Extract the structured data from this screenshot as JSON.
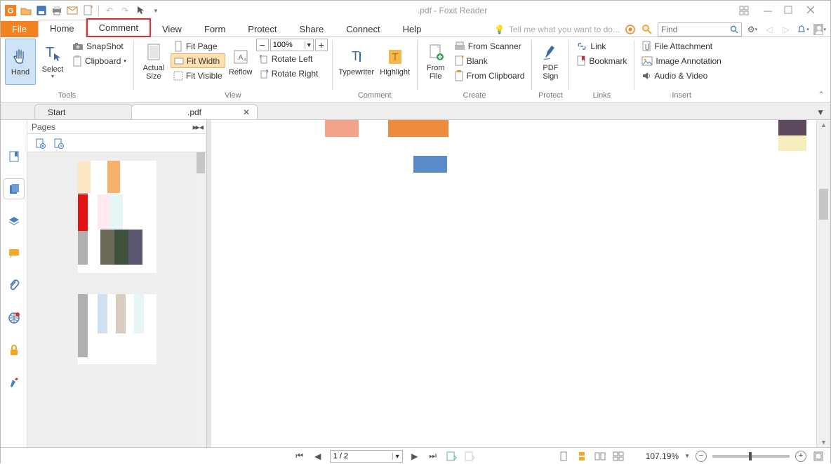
{
  "title": ".pdf - Foxit Reader",
  "tabs": {
    "file": "File",
    "home": "Home",
    "comment": "Comment",
    "view": "View",
    "form": "Form",
    "protect": "Protect",
    "share": "Share",
    "connect": "Connect",
    "help": "Help"
  },
  "search_hint": "Tell me what you want to do...",
  "find_placeholder": "Find",
  "ribbon": {
    "hand": "Hand",
    "select": "Select",
    "snapshot": "SnapShot",
    "clipboard": "Clipboard",
    "actual_size": "Actual\nSize",
    "fit_page": "Fit Page",
    "fit_width": "Fit Width",
    "fit_visible": "Fit Visible",
    "reflow": "Reflow",
    "rotate_left": "Rotate Left",
    "rotate_right": "Rotate Right",
    "zoom_value": "100%",
    "typewriter": "Typewriter",
    "highlight": "Highlight",
    "from_file": "From\nFile",
    "from_scanner": "From Scanner",
    "blank": "Blank",
    "from_clipboard": "From Clipboard",
    "pdf_sign": "PDF\nSign",
    "link": "Link",
    "bookmark": "Bookmark",
    "file_attachment": "File Attachment",
    "image_annotation": "Image Annotation",
    "audio_video": "Audio & Video",
    "groups": {
      "tools": "Tools",
      "view": "View",
      "comment": "Comment",
      "create": "Create",
      "protect": "Protect",
      "links": "Links",
      "insert": "Insert"
    }
  },
  "doc_tabs": {
    "start": "Start",
    "current": ".pdf"
  },
  "pages_panel": {
    "title": "Pages"
  },
  "status": {
    "page": "1 / 2",
    "zoom": "107.19%"
  }
}
